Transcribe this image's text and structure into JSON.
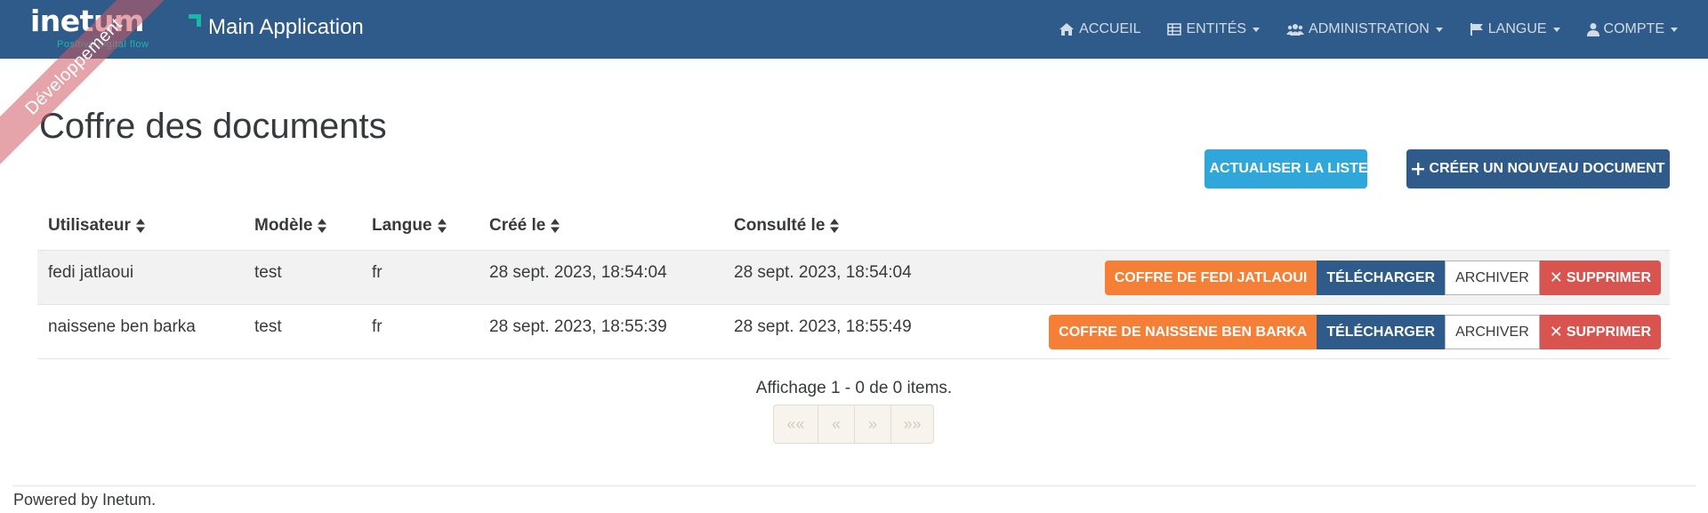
{
  "navbar": {
    "logo_text": "inetum",
    "logo_subtitle": "Positive digital flow",
    "app_title": "Main Application",
    "items": [
      {
        "label": "ACCUEIL",
        "icon": "home-icon"
      },
      {
        "label": "ENTITÉS",
        "icon": "table-icon"
      },
      {
        "label": "ADMINISTRATION",
        "icon": "users-icon"
      },
      {
        "label": "LANGUE",
        "icon": "flag-icon"
      },
      {
        "label": "COMPTE",
        "icon": "user-icon"
      }
    ]
  },
  "ribbon": "Développement",
  "page": {
    "title": "Coffre des documents",
    "refresh_label": "ACTUALISER LA LISTE",
    "create_label": "CRÉER UN NOUVEAU DOCUMENT"
  },
  "table": {
    "headers": [
      "Utilisateur",
      "Modèle",
      "Langue",
      "Créé le",
      "Consulté le"
    ],
    "rows": [
      {
        "user": "fedi jatlaoui",
        "model": "test",
        "lang": "fr",
        "created": "28 sept. 2023, 18:54:04",
        "viewed": "28 sept. 2023, 18:54:04",
        "vault_label": "COFFRE DE FEDI JATLAOUI",
        "download_label": "TÉLÉCHARGER",
        "archive_label": "ARCHIVER",
        "delete_label": "SUPPRIMER"
      },
      {
        "user": "naissene ben barka",
        "model": "test",
        "lang": "fr",
        "created": "28 sept. 2023, 18:55:39",
        "viewed": "28 sept. 2023, 18:55:49",
        "vault_label": "COFFRE DE NAISSENE BEN BARKA",
        "download_label": "TÉLÉCHARGER",
        "archive_label": "ARCHIVER",
        "delete_label": "SUPPRIMER"
      }
    ]
  },
  "pagination": {
    "info": "Affichage 1 - 0 de 0 items.",
    "first": "««",
    "prev": "«",
    "next": "»",
    "last": "»»"
  },
  "footer": {
    "text": "Powered by Inetum."
  },
  "colors": {
    "navbar": "#2e5b89",
    "refresh": "#2fa7db",
    "orange": "#f57f36",
    "red": "#d9534f"
  }
}
